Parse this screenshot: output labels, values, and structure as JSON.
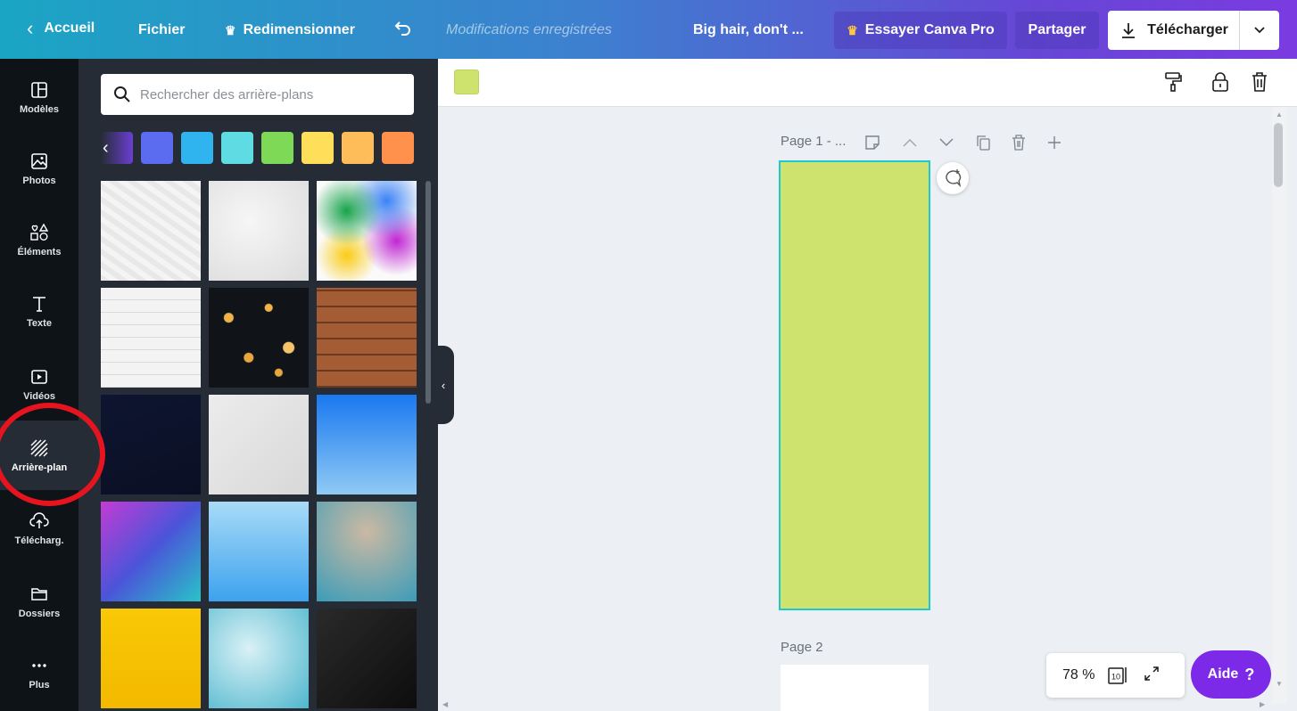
{
  "topbar": {
    "back_label": "Accueil",
    "file_label": "Fichier",
    "resize_label": "Redimensionner",
    "saved_status": "Modifications enregistrées",
    "doc_title": "Big hair, don't ...",
    "pro_label": "Essayer Canva Pro",
    "share_label": "Partager",
    "download_label": "Télécharger"
  },
  "rail": {
    "items": [
      {
        "label": "Modèles",
        "icon": "layout-icon"
      },
      {
        "label": "Photos",
        "icon": "image-icon"
      },
      {
        "label": "Éléments",
        "icon": "shapes-icon"
      },
      {
        "label": "Texte",
        "icon": "text-icon"
      },
      {
        "label": "Vidéos",
        "icon": "video-icon"
      },
      {
        "label": "Arrière-plan",
        "icon": "background-icon"
      },
      {
        "label": "Télécharg.",
        "icon": "upload-icon"
      },
      {
        "label": "Dossiers",
        "icon": "folder-icon"
      },
      {
        "label": "Plus",
        "icon": "more-icon"
      }
    ],
    "active": "Arrière-plan"
  },
  "panel": {
    "search_placeholder": "Rechercher des arrière-plans",
    "swatch_colors": [
      "#5b6cf0",
      "#2fb4f0",
      "#5fdbe3",
      "#7ed957",
      "#ffde59",
      "#ffbd59",
      "#ff914d"
    ],
    "thumbnails": [
      "crumpled-paper",
      "white-marble-light",
      "colored-smoke",
      "white-brick",
      "bokeh-lights",
      "wood-planks",
      "night-sky",
      "white-marble",
      "blue-sky-gradient",
      "polygon-gradient",
      "light-blue-gradient",
      "blurred-teal",
      "yellow-texture",
      "watercolor-teal",
      "black-marble"
    ]
  },
  "canvas": {
    "selected_color": "#cde36e",
    "page1_label": "Page 1 - ...",
    "page2_label": "Page 2",
    "zoom": "78 %",
    "page_count": "10",
    "help_label": "Aide",
    "help_mark": "?"
  }
}
